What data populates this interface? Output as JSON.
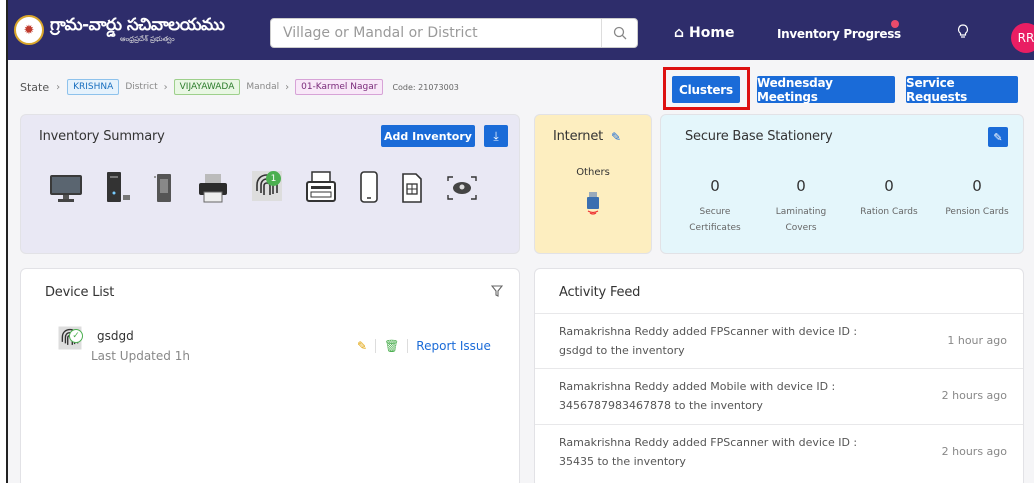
{
  "header": {
    "logo_title": "గ్రామ-వార్డు సచివాలయము",
    "logo_subtitle": "ఆంధ్రప్రదేశ్ ప్రభుత్వం",
    "search_placeholder": "Village or Mandal or District",
    "nav_home": "Home",
    "nav_inventory_progress": "Inventory Progress",
    "avatar_initials": "RR"
  },
  "breadcrumb": {
    "state": "State",
    "state_value": "KRISHNA",
    "district": "District",
    "district_value": "VIJAYAWADA",
    "mandal": "Mandal",
    "mandal_value": "01-Karmel Nagar",
    "code": "Code: 21073003"
  },
  "actions": {
    "clusters": "Clusters",
    "wednesday": "Wednesday Meetings",
    "service": "Service Requests"
  },
  "inventory_summary": {
    "title": "Inventory Summary",
    "add_label": "Add Inventory",
    "fingerprint_count": "1"
  },
  "internet": {
    "title": "Internet",
    "others": "Others"
  },
  "stationery": {
    "title": "Secure Base Stationery",
    "stats": [
      {
        "value": "0",
        "label1": "Secure",
        "label2": "Certificates"
      },
      {
        "value": "0",
        "label1": "Laminating",
        "label2": "Covers"
      },
      {
        "value": "0",
        "label1": "Ration Cards",
        "label2": ""
      },
      {
        "value": "0",
        "label1": "Pension Cards",
        "label2": ""
      }
    ]
  },
  "device_list": {
    "title": "Device List",
    "name": "gsdgd",
    "updated": "Last Updated 1h",
    "report": "Report Issue"
  },
  "activity": {
    "title": "Activity Feed",
    "items": [
      {
        "text": "Ramakrishna Reddy added FPScanner with device ID : gsdgd to the inventory",
        "time": "1 hour ago"
      },
      {
        "text": "Ramakrishna Reddy added Mobile with device ID : 3456787983467878 to the inventory",
        "time": "2 hours ago"
      },
      {
        "text": "Ramakrishna Reddy added FPScanner with device ID : 35435 to the inventory",
        "time": "2 hours ago"
      }
    ]
  },
  "colors": {
    "topbar": "#2e2d6b",
    "primary": "#1a6bd8",
    "highlight": "#dd1111",
    "avatar": "#e91e63"
  }
}
